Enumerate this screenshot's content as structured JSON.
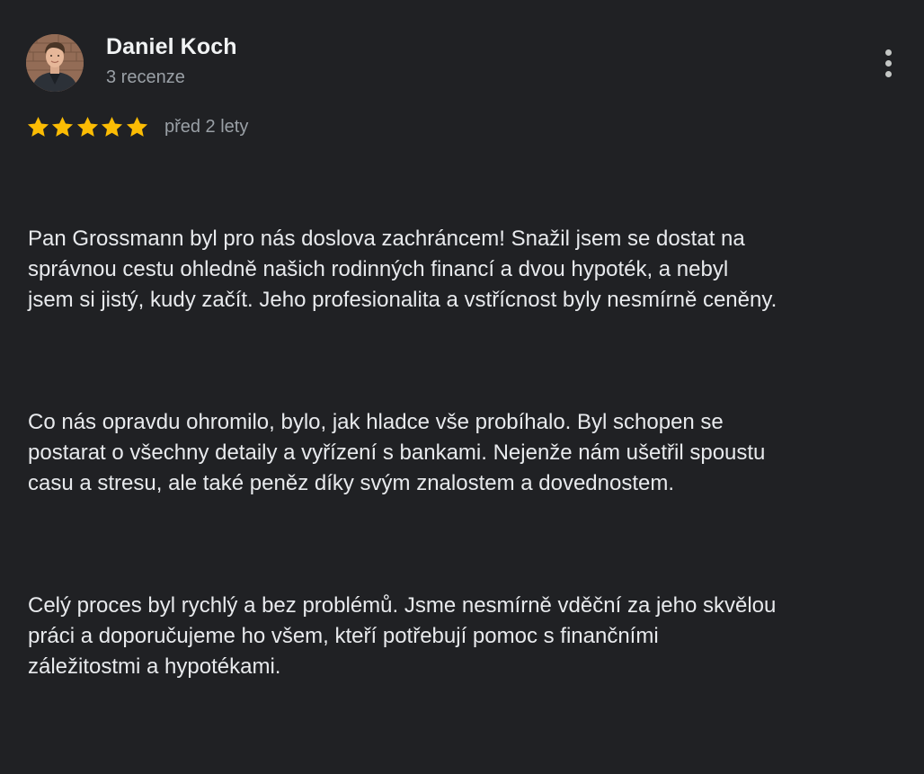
{
  "review": {
    "author": {
      "name": "Daniel Koch",
      "meta": "3 recenze",
      "avatar_icon": "user-avatar-photo"
    },
    "menu_icon": "more-vert-icon",
    "rating": {
      "stars": 5,
      "max": 5,
      "star_color": "#fbbc04",
      "star_icon": "star-icon"
    },
    "date": "před 2 lety",
    "paragraphs": [
      "Pan Grossmann byl pro nás doslova zachráncem! Snažil jsem se dostat na\nsprávnou cestu ohledně našich rodinných financí a dvou hypoték, a nebyl\njsem si jistý, kudy začít. Jeho profesionalita a vstřícnost byly nesmírně ceněny.",
      "Co nás opravdu ohromilo, bylo, jak hladce vše probíhalo. Byl schopen se\npostarat o všechny detaily a vyřízení s bankami. Nejenže nám ušetřil spoustu\ncasu a stresu, ale také peněz díky svým znalostem a dovednostem.",
      "Celý proces byl rychlý a bez problémů. Jsme nesmírně vděční za jeho skvělou\npráci a doporučujeme ho všem, kteří potřebují pomoc s finančními\nzáležitostmi a hypotékami."
    ]
  },
  "colors": {
    "background": "#202124",
    "text_primary": "#e8eaed",
    "text_secondary": "#9aa0a6"
  }
}
